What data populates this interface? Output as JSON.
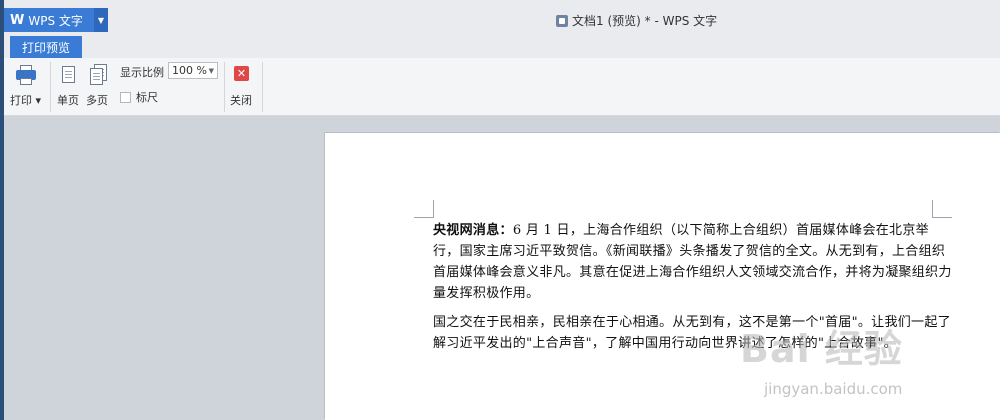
{
  "app": {
    "name": "WPS 文字",
    "logo": "W",
    "window_title": "文档1 (预览)  * - WPS 文字"
  },
  "tabs": [
    {
      "label": "打印预览",
      "active": true
    }
  ],
  "toolbar": {
    "print_label": "打印",
    "single_page_label": "单页",
    "multi_page_label": "多页",
    "zoom_label": "显示比例",
    "zoom_value": "100 %",
    "ruler_label": "标尺",
    "ruler_checked": false,
    "close_label": "关闭"
  },
  "document": {
    "para1_bold": "央视网消息：",
    "para1_rest": "6 月 1 日，上海合作组织（以下简称上合组织）首届媒体峰会在北京举行，国家主席习近平致贺信。《新闻联播》头条播发了贺信的全文。从无到有，上合组织首届媒体峰会意义非凡。其意在促进上海合作组织人文领域交流合作，并将为凝聚组织力量发挥积极作用。",
    "para2": "国之交在于民相亲，民相亲在于心相通。从无到有，这不是第一个\"首届\"。让我们一起了解习近平发出的\"上合声音\"，了解中国用行动向世界讲述了怎样的\"上合故事\"。"
  },
  "watermark": {
    "text": "Bai 经验",
    "url": "jingyan.baidu.com"
  },
  "colors": {
    "accent": "#3a7bd5",
    "close_red": "#e04848",
    "workspace": "#cfd3da"
  }
}
